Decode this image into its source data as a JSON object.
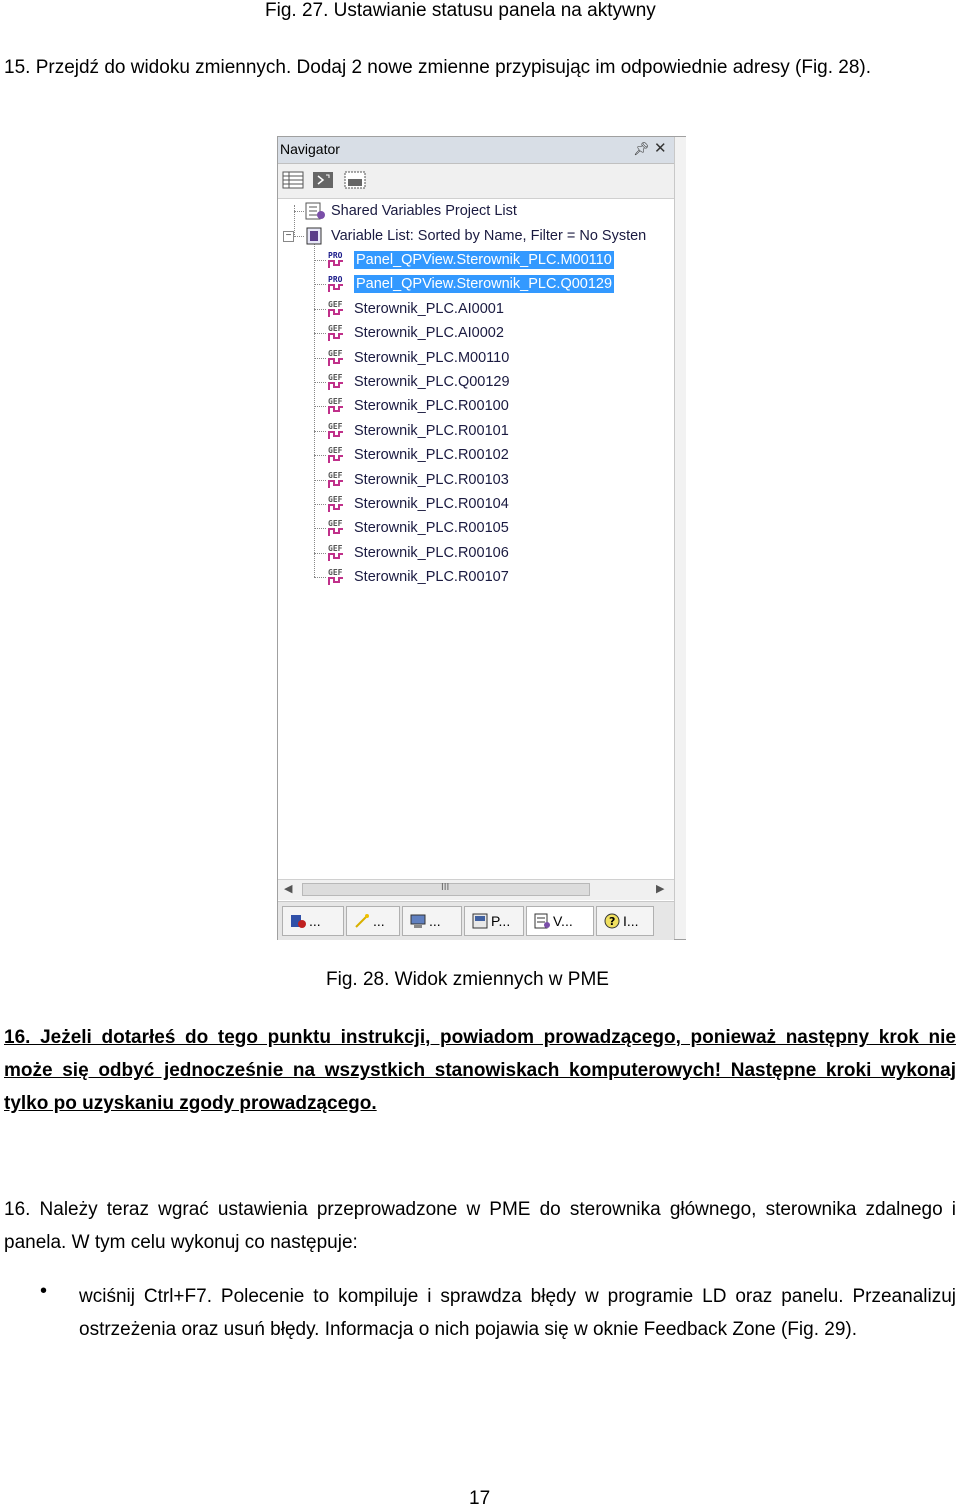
{
  "fig27_caption": "Fig. 27. Ustawianie statusu panela na aktywny",
  "step15": "15. Przejdź do widoku zmiennych. Dodaj 2 nowe zmienne przypisując im odpowiednie adresy (Fig. 28).",
  "navigator": {
    "title": "Navigator",
    "pin_icon": "pin-icon",
    "close_icon": "close-icon",
    "toolbar_icons": [
      "grid-view-icon",
      "move-icon",
      "filter-icon"
    ],
    "shared_list": "Shared Variables Project List",
    "variable_list": "Variable List: Sorted by Name, Filter = No Systen",
    "variables": [
      {
        "badge": "PRO",
        "name": "Panel_QPView.Sterownik_PLC.M00110",
        "selected": true
      },
      {
        "badge": "PRO",
        "name": "Panel_QPView.Sterownik_PLC.Q00129",
        "selected": true
      },
      {
        "badge": "GEF",
        "name": "Sterownik_PLC.AI0001",
        "selected": false
      },
      {
        "badge": "GEF",
        "name": "Sterownik_PLC.AI0002",
        "selected": false
      },
      {
        "badge": "GEF",
        "name": "Sterownik_PLC.M00110",
        "selected": false
      },
      {
        "badge": "GEF",
        "name": "Sterownik_PLC.Q00129",
        "selected": false
      },
      {
        "badge": "GEF",
        "name": "Sterownik_PLC.R00100",
        "selected": false
      },
      {
        "badge": "GEF",
        "name": "Sterownik_PLC.R00101",
        "selected": false
      },
      {
        "badge": "GEF",
        "name": "Sterownik_PLC.R00102",
        "selected": false
      },
      {
        "badge": "GEF",
        "name": "Sterownik_PLC.R00103",
        "selected": false
      },
      {
        "badge": "GEF",
        "name": "Sterownik_PLC.R00104",
        "selected": false
      },
      {
        "badge": "GEF",
        "name": "Sterownik_PLC.R00105",
        "selected": false
      },
      {
        "badge": "GEF",
        "name": "Sterownik_PLC.R00106",
        "selected": false
      },
      {
        "badge": "GEF",
        "name": "Sterownik_PLC.R00107",
        "selected": false
      }
    ],
    "scroll_grip": "III",
    "tabs": [
      {
        "label": "...",
        "icon": "project-icon"
      },
      {
        "label": "...",
        "icon": "wand-icon"
      },
      {
        "label": "...",
        "icon": "computer-icon"
      },
      {
        "label": "P...",
        "icon": "panel-icon"
      },
      {
        "label": "V...",
        "icon": "variables-icon"
      },
      {
        "label": "I...",
        "icon": "help-icon"
      }
    ]
  },
  "fig28_caption": "Fig. 28. Widok zmiennych w PME",
  "warning": "16. Jeżeli dotarłeś do tego punktu instrukcji, powiadom prowadzącego, ponieważ następny krok nie może się odbyć jednocześnie na wszystkich stanowiskach komputerowych! Następne kroki wykonaj tylko po uzyskaniu zgody prowadzącego.",
  "step16": "16. Należy teraz wgrać ustawienia przeprowadzone w PME do sterownika głównego, sterownika zdalnego i panela. W tym celu wykonuj co następuje:",
  "bullet1": "wciśnij Ctrl+F7. Polecenie to kompiluje i sprawdza błędy w programie LD oraz panelu. Przeanalizuj ostrzeżenia oraz usuń błędy. Informacja o nich pojawia się w oknie Feedback Zone (Fig. 29).",
  "page_number": "17"
}
